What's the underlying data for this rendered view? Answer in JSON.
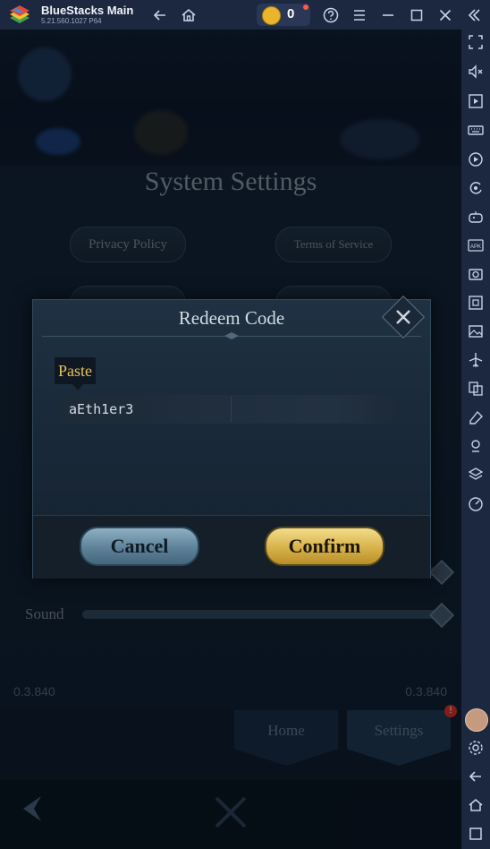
{
  "app": {
    "name": "BlueStacks Main",
    "version": "5.21.560.1027  P64",
    "coins": "0"
  },
  "colors": {
    "titlebar": "#1c2740",
    "confirm_gold": "#d7b24a",
    "cancel_blue": "#5d8198",
    "paste_text": "#e8c25a",
    "notification_red": "#c8281f"
  },
  "titlebar_icons": [
    "back-arrow-icon",
    "home-icon",
    "help-icon",
    "menu-icon",
    "minimize-icon",
    "maximize-icon",
    "close-icon",
    "collapse-sidebar-icon"
  ],
  "sidebar_icons": [
    "fullscreen-icon",
    "volume-icon",
    "screen-record-icon",
    "keyboard-icon",
    "macro-icon",
    "rotate-icon",
    "gamepad-icon",
    "apk-icon",
    "screenshot-icon",
    "resize-icon",
    "media-icon",
    "airplane-icon",
    "multi-instance-icon",
    "erase-icon",
    "location-icon",
    "layers-icon",
    "performance-icon",
    "avatar-icon",
    "settings-icon",
    "back-icon",
    "home-icon",
    "recent-apps-icon"
  ],
  "settings": {
    "title": "System Settings",
    "buttons": {
      "privacy": "Privacy Policy",
      "terms": "Terms of Service"
    },
    "sound_label": "Sound",
    "sound_level": 1.0,
    "music_level": 1.0,
    "version_left": "0.3.840",
    "version_right": "0.3.840"
  },
  "tabs": {
    "home": "Home",
    "settings": "Settings"
  },
  "dialog": {
    "title": "Redeem Code",
    "paste_tooltip": "Paste",
    "code_value": "aEth1er3",
    "cancel": "Cancel",
    "confirm": "Confirm"
  }
}
